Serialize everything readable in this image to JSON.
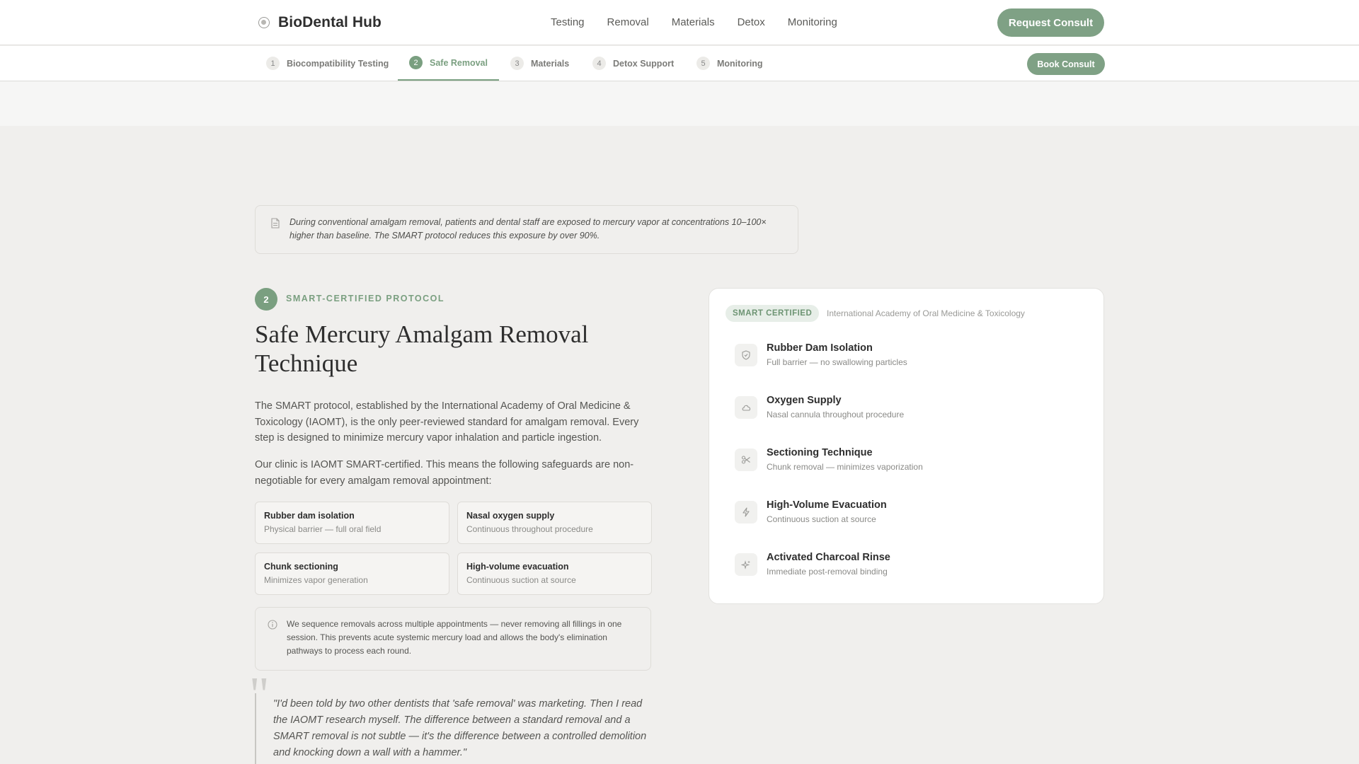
{
  "header": {
    "brand": "BioDental Hub",
    "nav": [
      "Testing",
      "Removal",
      "Materials",
      "Detox",
      "Monitoring"
    ],
    "cta": "Request Consult"
  },
  "steps": [
    {
      "num": "1",
      "label": "Biocompatibility Testing"
    },
    {
      "num": "2",
      "label": "Safe Removal"
    },
    {
      "num": "3",
      "label": "Materials"
    },
    {
      "num": "4",
      "label": "Detox Support"
    },
    {
      "num": "5",
      "label": "Monitoring"
    }
  ],
  "step_cta": "Book Consult",
  "callout": "During conventional amalgam removal, patients and dental staff are exposed to mercury vapor at concentrations 10–100× higher than baseline. The SMART protocol reduces this exposure by over 90%.",
  "section": {
    "number": "2",
    "eyebrow": "SMART-CERTIFIED PROTOCOL",
    "title": "Safe Mercury Amalgam Removal Technique",
    "para1": "The SMART protocol, established by the International Academy of Oral Medicine & Toxicology (IAOMT), is the only peer-reviewed standard for amalgam removal. Every step is designed to minimize mercury vapor inhalation and particle ingestion.",
    "para2": "Our clinic is IAOMT SMART-certified. This means the following safeguards are non-negotiable for every amalgam removal appointment:"
  },
  "features": [
    {
      "title": "Rubber dam isolation",
      "desc": "Physical barrier — full oral field"
    },
    {
      "title": "Nasal oxygen supply",
      "desc": "Continuous throughout procedure"
    },
    {
      "title": "Chunk sectioning",
      "desc": "Minimizes vapor generation"
    },
    {
      "title": "High-volume evacuation",
      "desc": "Continuous suction at source"
    }
  ],
  "note": "We sequence removals across multiple appointments — never removing all fillings in one session. This prevents acute systemic mercury load and allows the body's elimination pathways to process each round.",
  "quote": "\"I'd been told by two other dentists that 'safe removal' was marketing. Then I read the IAOMT research myself. The difference between a standard removal and a SMART removal is not subtle — it's the difference between a controlled demolition and knocking down a wall with a hammer.\"",
  "card": {
    "badge": "SMART CERTIFIED",
    "org": "International Academy of Oral Medicine & Toxicology",
    "items": [
      {
        "icon": "shield-icon",
        "title": "Rubber Dam Isolation",
        "desc": "Full barrier — no swallowing particles"
      },
      {
        "icon": "cloud-icon",
        "title": "Oxygen Supply",
        "desc": "Nasal cannula throughout procedure"
      },
      {
        "icon": "scissors-icon",
        "title": "Sectioning Technique",
        "desc": "Chunk removal — minimizes vaporization"
      },
      {
        "icon": "lightning-icon",
        "title": "High-Volume Evacuation",
        "desc": "Continuous suction at source"
      },
      {
        "icon": "sparkle-icon",
        "title": "Activated Charcoal Rinse",
        "desc": "Immediate post-removal binding"
      }
    ]
  },
  "colors": {
    "accent": "#7fa185",
    "background": "#f0efed"
  }
}
